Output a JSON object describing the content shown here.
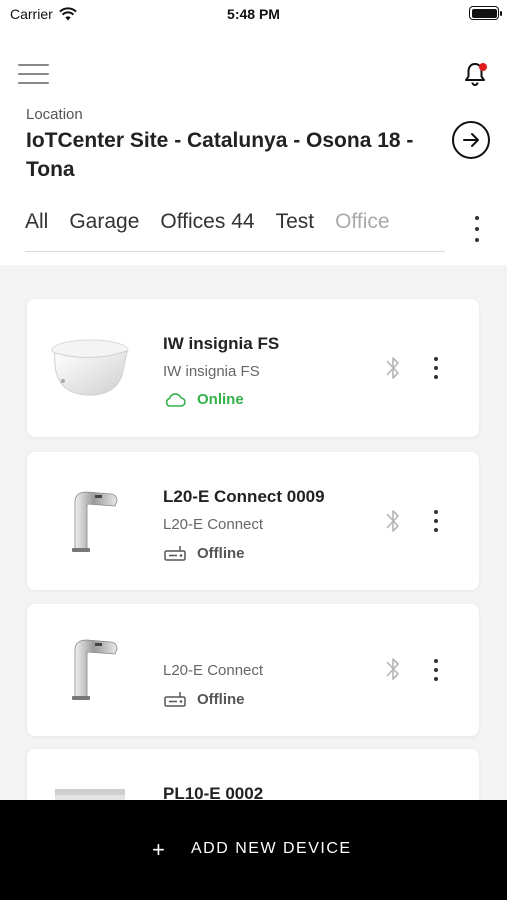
{
  "status_bar": {
    "carrier": "Carrier",
    "time": "5:48 PM"
  },
  "header": {
    "location_label": "Location",
    "location_name": "IoTCenter Site - Catalunya - Osona 18 - Tona",
    "notification_dot_color": "#e21b1b"
  },
  "tabs": [
    "All",
    "Garage",
    "Offices 44",
    "Test",
    "Office"
  ],
  "devices": [
    {
      "name": "IW insignia FS",
      "model": "IW insignia FS",
      "status": "Online",
      "icon": "cloud-icon",
      "type": "toilet"
    },
    {
      "name": "L20-E Connect 0009",
      "model": "L20-E Connect",
      "status": "Offline",
      "icon": "gateway-icon",
      "type": "faucet"
    },
    {
      "name": "",
      "model": "L20-E Connect",
      "status": "Offline",
      "icon": "gateway-icon",
      "type": "faucet"
    },
    {
      "name": "PL10-E 0002",
      "model": "",
      "status": "",
      "icon": "",
      "type": "unit"
    }
  ],
  "bottom": {
    "plus": "+",
    "label": "ADD NEW DEVICE"
  },
  "colors": {
    "online": "#33b24a",
    "accent": "#000000"
  }
}
